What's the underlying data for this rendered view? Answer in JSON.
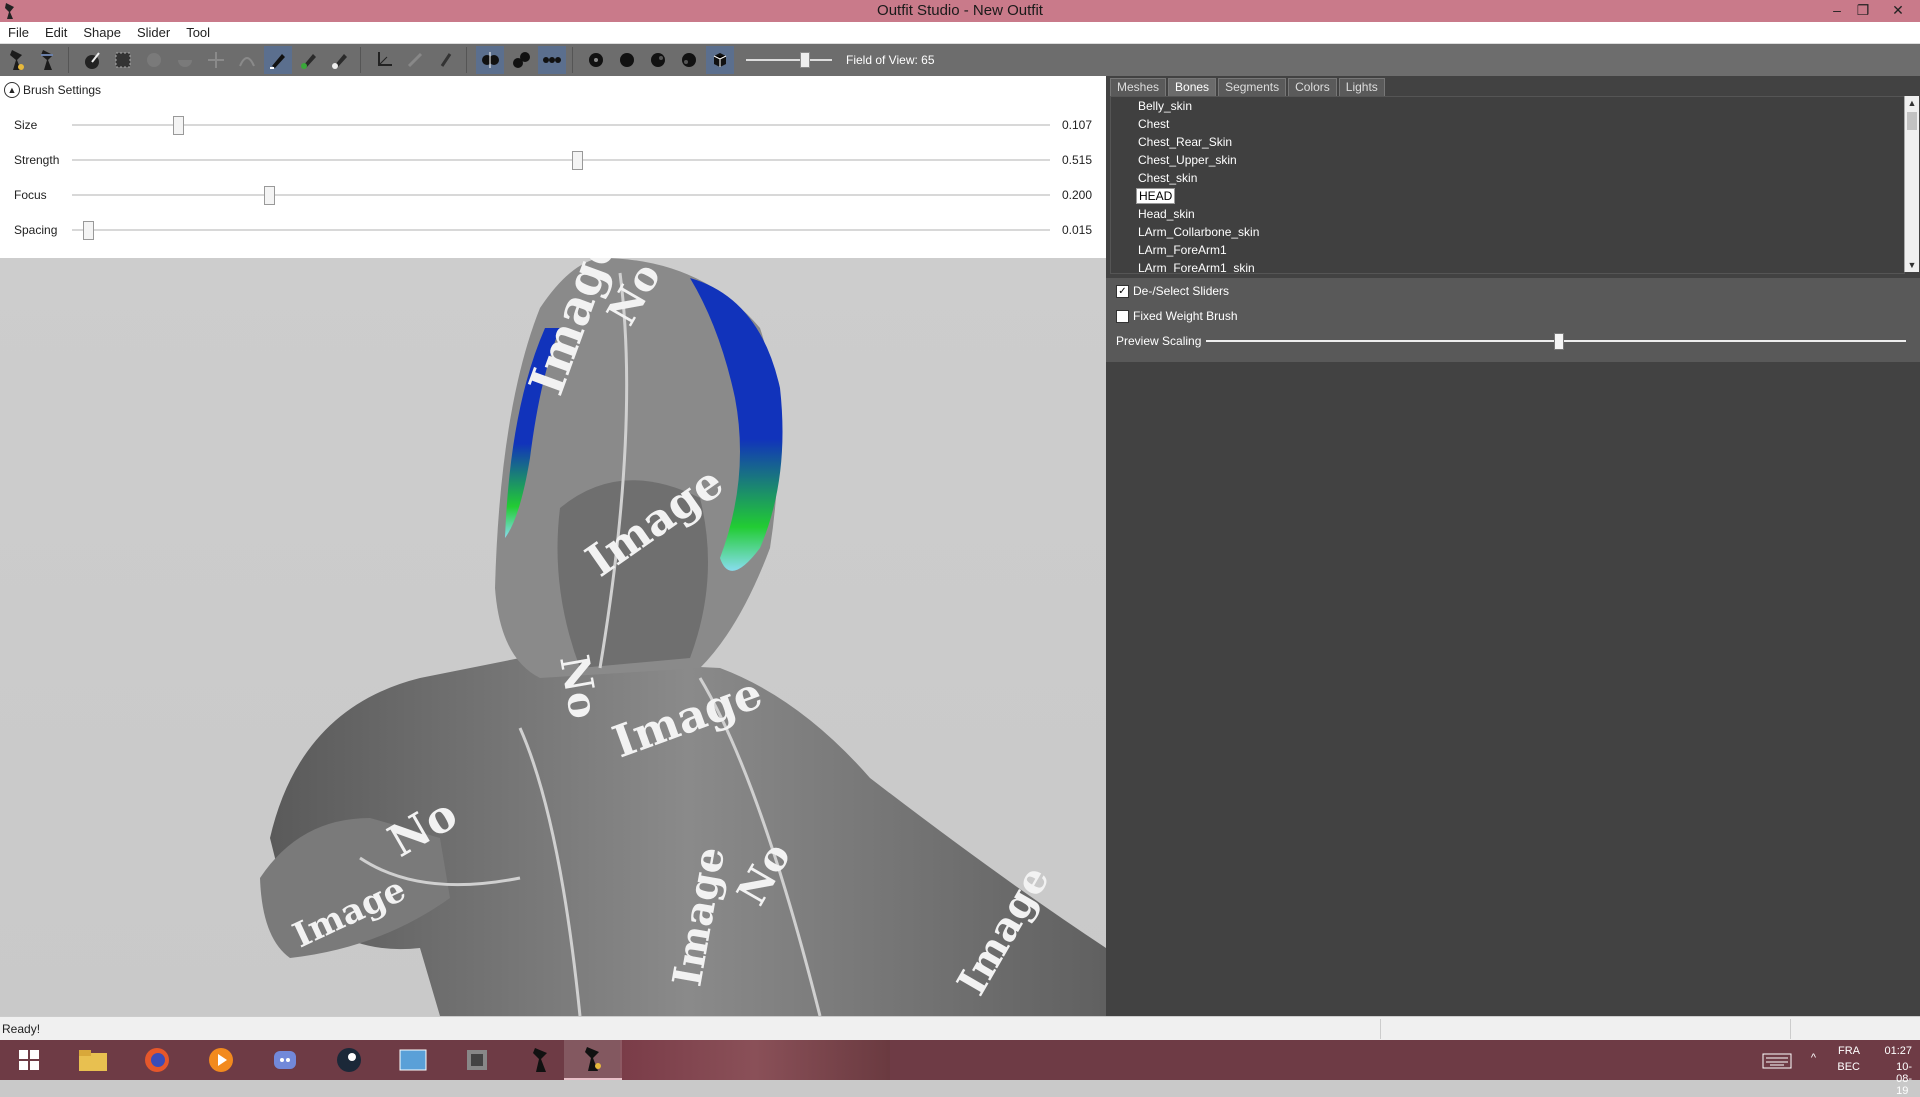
{
  "window": {
    "title": "Outfit Studio - New Outfit"
  },
  "menu": [
    "File",
    "Edit",
    "Shape",
    "Slider",
    "Tool"
  ],
  "toolbar": {
    "fov_label": "Field of View: 65",
    "fov_value": 65
  },
  "brush_settings": {
    "header": "Brush Settings",
    "rows": [
      {
        "label": "Size",
        "value": "0.107",
        "fraction": 0.107
      },
      {
        "label": "Strength",
        "value": "0.515",
        "fraction": 0.515
      },
      {
        "label": "Focus",
        "value": "0.200",
        "fraction": 0.2
      },
      {
        "label": "Spacing",
        "value": "0.015",
        "fraction": 0.015
      }
    ]
  },
  "tabs": [
    "Meshes",
    "Bones",
    "Segments",
    "Colors",
    "Lights"
  ],
  "bones": [
    "Belly_skin",
    "Chest",
    "Chest_Rear_Skin",
    "Chest_Upper_skin",
    "Chest_skin",
    "HEAD",
    "Head_skin",
    "LArm_Collarbone_skin",
    "LArm_ForeArm1",
    "LArm_ForeArm1_skin"
  ],
  "selected_bone": "HEAD",
  "options": {
    "deselect_sliders": "De-/Select Sliders",
    "fixed_weight": "Fixed Weight Brush",
    "preview_scaling": "Preview Scaling",
    "preview_scaling_value": 0.5
  },
  "viewport": {
    "texture_text": [
      "Image",
      "No",
      "Image",
      "No",
      "Image",
      "No",
      "Image",
      "No",
      "Image",
      "Image"
    ]
  },
  "status": {
    "text": "Ready!"
  },
  "tray": {
    "lang1": "FRA",
    "lang2": "BEC",
    "time": "01:27",
    "date": "10-08-19"
  },
  "colors": {
    "titlebar": "#c97a8a",
    "toolbar": "#6d6d6d",
    "panel": "#424242",
    "weight_blue": "#1133bb",
    "weight_green": "#22cc33"
  }
}
